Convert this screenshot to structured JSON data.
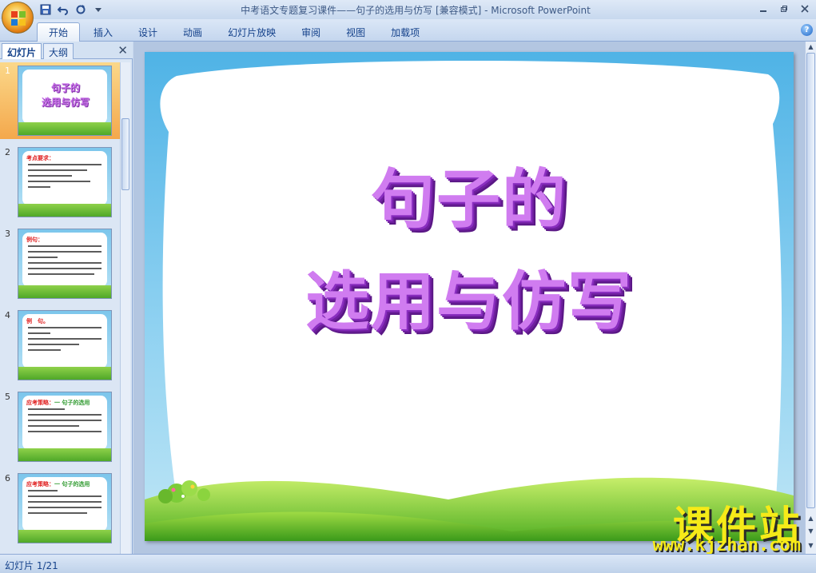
{
  "window": {
    "title": "中考语文专题复习课件——句子的选用与仿写 [兼容模式] - Microsoft PowerPoint"
  },
  "quick_access": [
    {
      "name": "save-icon"
    },
    {
      "name": "undo-icon"
    },
    {
      "name": "redo-icon"
    },
    {
      "name": "customize-icon"
    }
  ],
  "ribbon": {
    "tabs": [
      "开始",
      "插入",
      "设计",
      "动画",
      "幻灯片放映",
      "审阅",
      "视图",
      "加载项"
    ],
    "active_tab": "开始"
  },
  "panel": {
    "tabs": [
      "幻灯片",
      "大纲"
    ],
    "active": "幻灯片"
  },
  "slides": [
    {
      "num": "1",
      "title_line1": "句子的",
      "title_line2": "选用与仿写"
    },
    {
      "num": "2",
      "heading": "考点要求："
    },
    {
      "num": "3",
      "heading": "例句："
    },
    {
      "num": "4",
      "heading": "例　句。"
    },
    {
      "num": "5",
      "heading": "应考策略：",
      "heading_green": "一 句子的选用"
    },
    {
      "num": "6",
      "heading": "应考策略：",
      "heading_green": "一 句子的选用"
    }
  ],
  "slide": {
    "title_line1": "句子的",
    "title_line2": "选用与仿写"
  },
  "watermark": {
    "cn": "课件站",
    "url": "www.kjzhan.com"
  },
  "status": {
    "slide_indicator": "幻灯片 1/21"
  },
  "colors": {
    "title_fill": "#d07cf0",
    "title_shadow": "#6e1f9e",
    "selected_thumb": "#f4a84c",
    "watermark": "#f6ea18"
  }
}
